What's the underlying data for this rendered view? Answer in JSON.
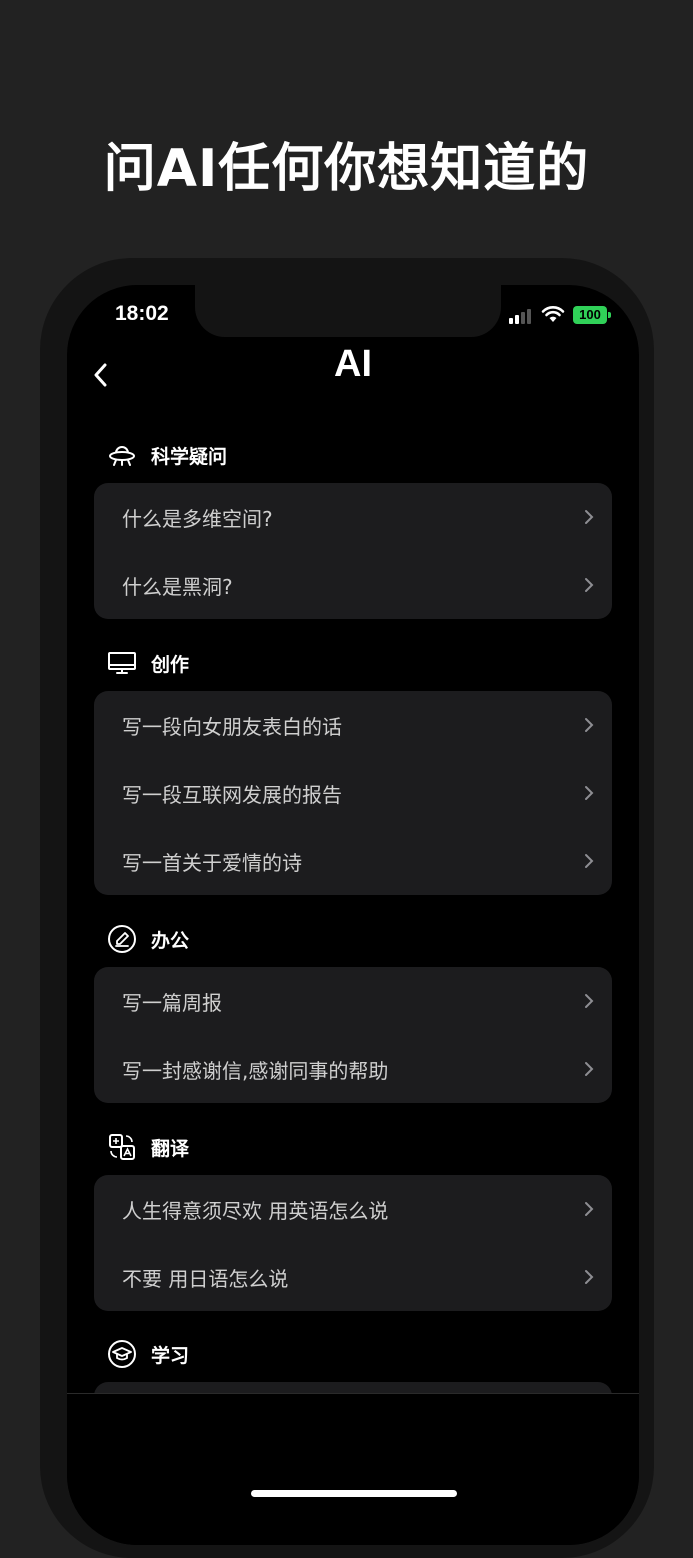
{
  "headline": "问AI任何你想知道的",
  "status": {
    "time": "18:02",
    "battery": "100"
  },
  "nav": {
    "title": "AI"
  },
  "colors": {
    "battery": "#30d158",
    "card_bg": "#1c1c1e",
    "row_text": "#cfcfcf"
  },
  "sections": [
    {
      "icon": "ufo-icon",
      "title": "科学疑问",
      "items": [
        "什么是多维空间?",
        "什么是黑洞?"
      ]
    },
    {
      "icon": "monitor-icon",
      "title": "创作",
      "items": [
        "写一段向女朋友表白的话",
        "写一段互联网发展的报告",
        "写一首关于爱情的诗"
      ]
    },
    {
      "icon": "edit-circle-icon",
      "title": "办公",
      "items": [
        "写一篇周报",
        "写一封感谢信,感谢同事的帮助"
      ]
    },
    {
      "icon": "translate-icon",
      "title": "翻译",
      "items": [
        "人生得意须尽欢 用英语怎么说",
        "不要 用日语怎么说"
      ]
    },
    {
      "icon": "graduation-cap-icon",
      "title": "学习",
      "items": []
    }
  ]
}
